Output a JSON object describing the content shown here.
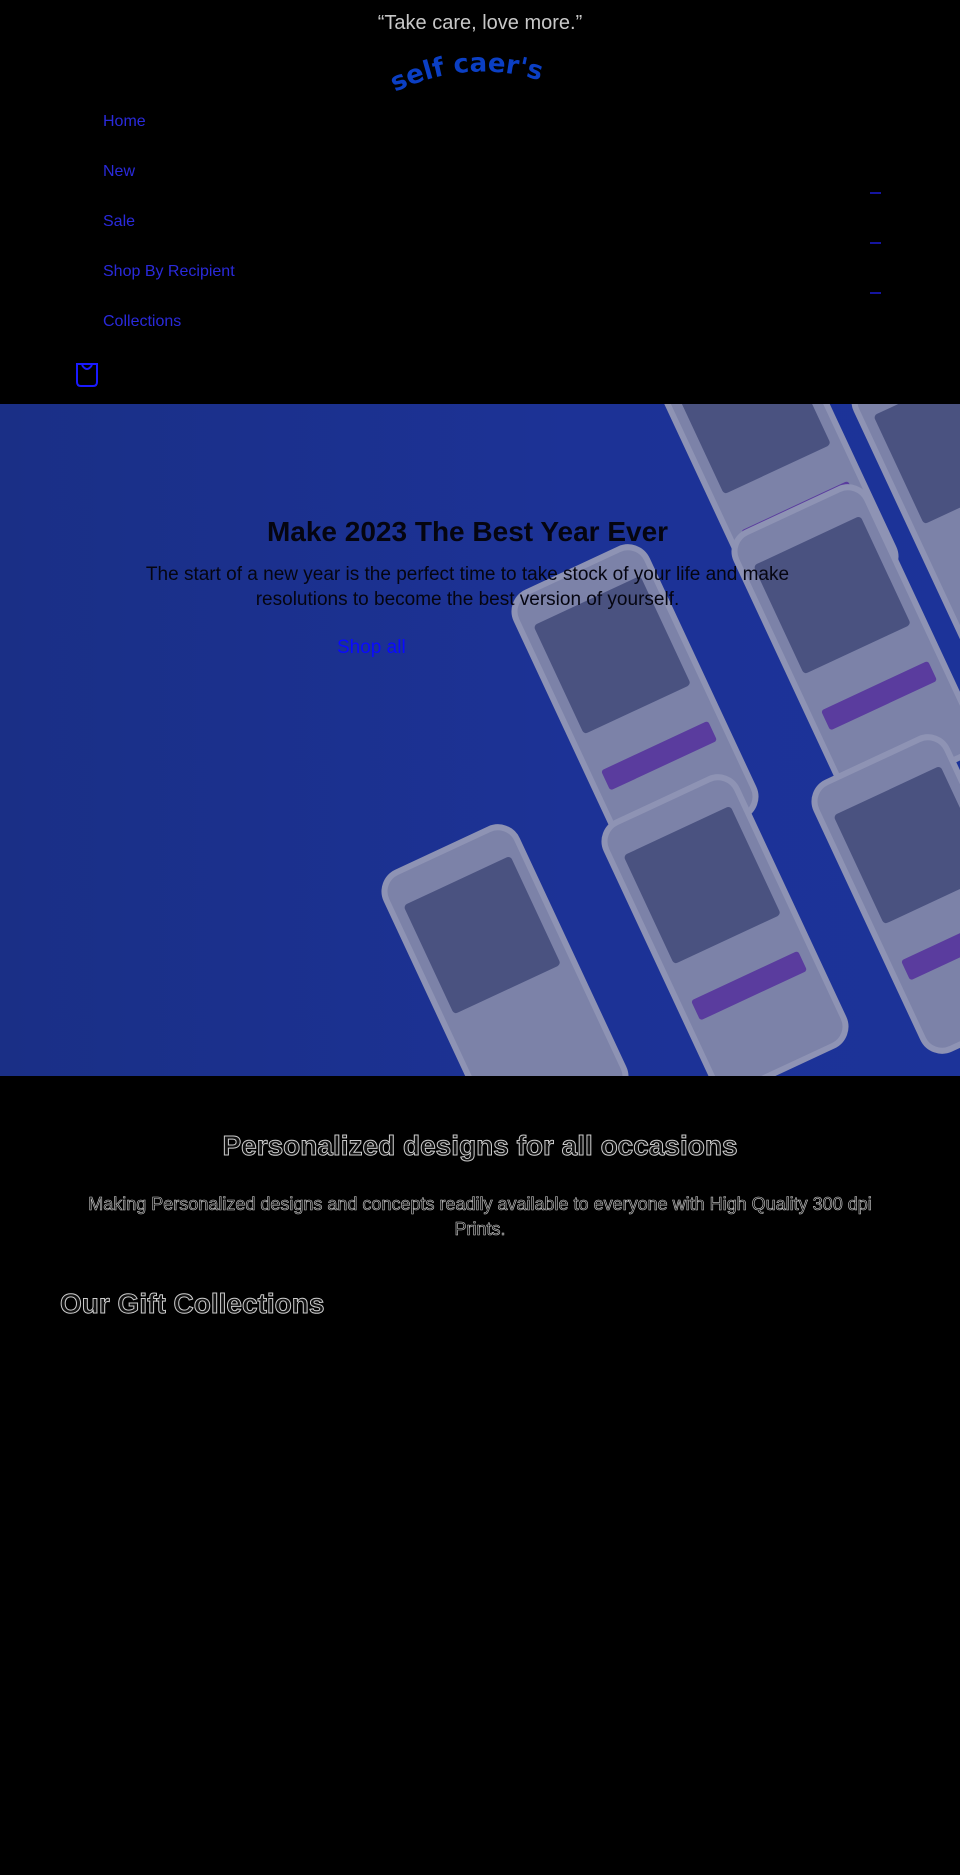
{
  "announcement": {
    "text": "“Take care, love more.”"
  },
  "logo": {
    "text": "self caer's",
    "color": "#0b3fc4"
  },
  "nav": {
    "items": [
      {
        "label": "Home"
      },
      {
        "label": "New"
      },
      {
        "label": "Sale"
      },
      {
        "label": "Shop By Recipient"
      },
      {
        "label": "Collections"
      }
    ]
  },
  "icons": {
    "cart": "shopping-bag-icon"
  },
  "hero": {
    "title": "Make 2023 The Best Year Ever",
    "subtitle": "The start of a new year is the perfect time to take stock of your life and make resolutions to become the best version of yourself.",
    "button": "Shop all",
    "bg_color": "#1b3190"
  },
  "intro": {
    "title": "Personalized designs for all occasions",
    "text": "Making Personalized designs and concepts readily available to everyone with High Quality 300 dpi Prints."
  },
  "collections": {
    "title": "Our Gift Collections"
  }
}
